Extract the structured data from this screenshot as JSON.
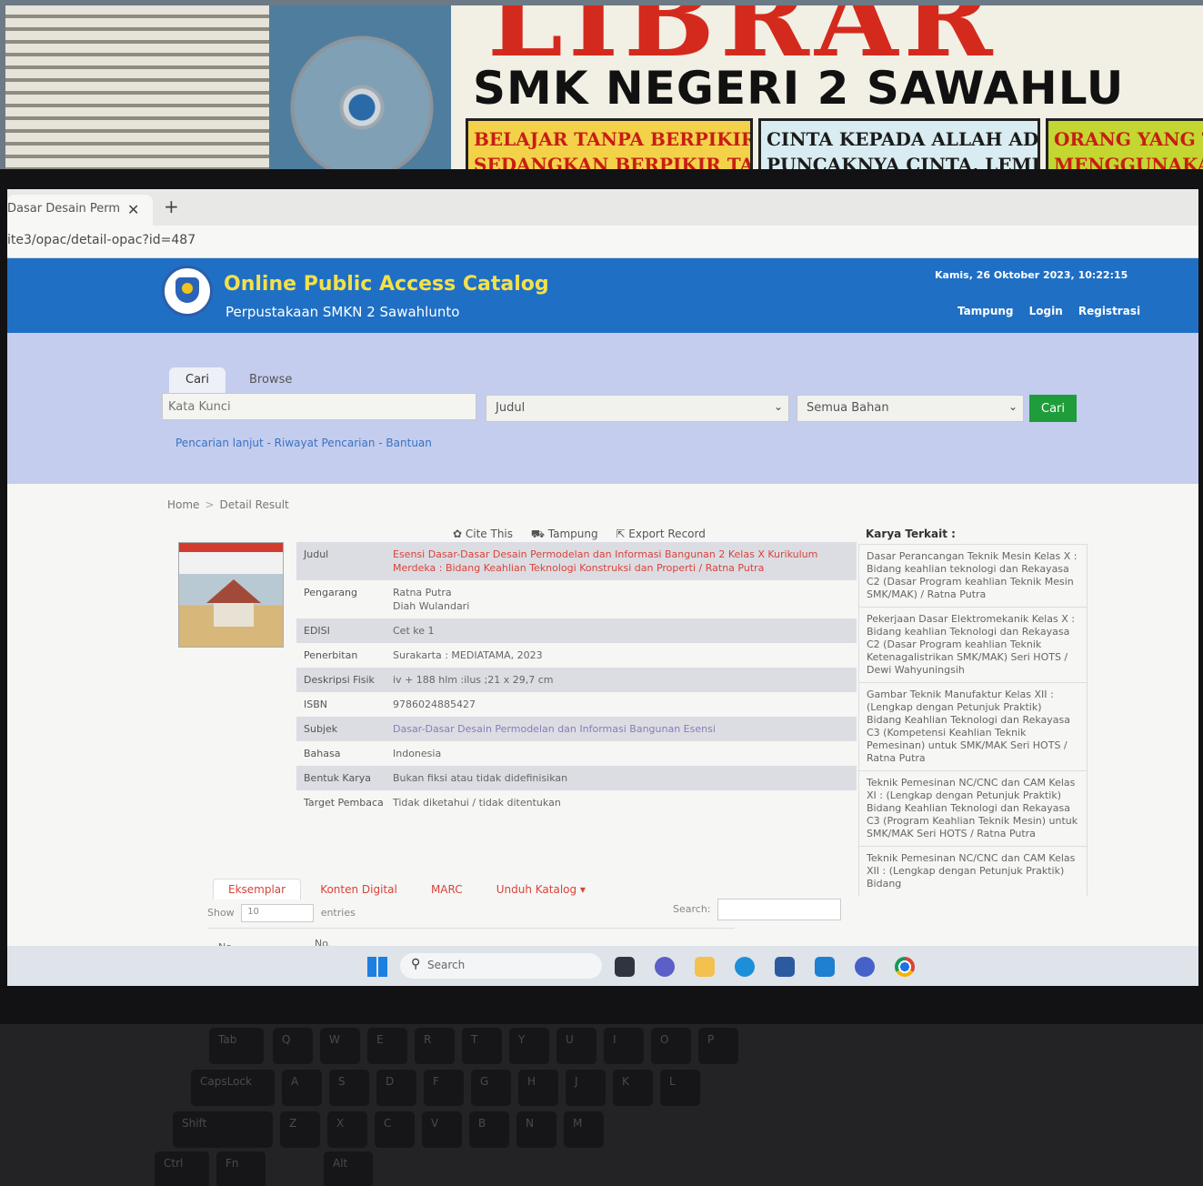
{
  "background": {
    "banner_big": "LIBRAR",
    "banner_school": "SMK NEGERI 2 SAWAHLU",
    "quote1": [
      "BELAJAR TANPA BERPIKIR TIDAK ADA GUNANYA,",
      "SEDANGKAN BERPIKIR TANPA BELAJAR"
    ],
    "quote2": [
      "CINTA KEPADA ALLAH ADALAH",
      "PUNCAKNYA CINTA, LEMBAHNYA CINTA"
    ],
    "quote3": [
      "ORANG YANG TE",
      "MENGGUNAKAN WAK"
    ]
  },
  "browser": {
    "tab_title": "Dasar Desain Perm",
    "tab_close": "✕",
    "new_tab": "+",
    "url": "ite3/opac/detail-opac?id=487"
  },
  "header": {
    "title": "Online Public Access Catalog",
    "subtitle": "Perpustakaan SMKN 2 Sawahlunto",
    "datetime": "Kamis, 26 Oktober 2023, 10:22:15",
    "nav": [
      "Tampung",
      "Login",
      "Registrasi"
    ]
  },
  "search": {
    "tabs": [
      "Cari",
      "Browse"
    ],
    "keyword_placeholder": "Kata Kunci",
    "field_select": "Judul",
    "material_select": "Semua Bahan",
    "submit_label": "Cari",
    "links": "Pencarian lanjut - Riwayat Pencarian - Bantuan"
  },
  "breadcrumb": {
    "home": "Home",
    "sep": ">",
    "current": "Detail Result"
  },
  "actions": {
    "cite": "✿ Cite This",
    "tampung": "⛟ Tampung",
    "export": "⇱ Export Record"
  },
  "detail": {
    "rows": [
      {
        "label": "Judul",
        "value": "Esensi Dasar-Dasar Desain Permodelan dan Informasi Bangunan 2 Kelas X Kurikulum Merdeka : Bidang Keahlian Teknologi Konstruksi dan Properti / Ratna Putra"
      },
      {
        "label": "Pengarang",
        "value": "Ratna Putra\nDiah Wulandari"
      },
      {
        "label": "EDISI",
        "value": "Cet ke 1"
      },
      {
        "label": "Penerbitan",
        "value": "Surakarta : MEDIATAMA, 2023"
      },
      {
        "label": "Deskripsi Fisik",
        "value": "iv + 188 hlm :ilus ;21 x 29,7 cm"
      },
      {
        "label": "ISBN",
        "value": "9786024885427"
      },
      {
        "label": "Subjek",
        "value": "Dasar-Dasar Desain Permodelan dan Informasi Bangunan Esensi"
      },
      {
        "label": "Bahasa",
        "value": "Indonesia"
      },
      {
        "label": "Bentuk Karya",
        "value": "Bukan fiksi atau tidak didefinisikan"
      },
      {
        "label": "Target Pembaca",
        "value": "Tidak diketahui / tidak ditentukan"
      }
    ]
  },
  "related": {
    "heading": "Karya Terkait :",
    "items": [
      "Dasar Perancangan Teknik Mesin Kelas X : Bidang keahlian teknologi dan Rekayasa C2 (Dasar Program keahlian Teknik Mesin SMK/MAK) / Ratna Putra",
      "Pekerjaan Dasar Elektromekanik Kelas X : Bidang keahlian Teknologi dan Rekayasa C2 (Dasar Program keahlian Teknik Ketenagalistrikan SMK/MAK) Seri HOTS / Dewi Wahyuningsih",
      "Gambar Teknik Manufaktur Kelas XII : (Lengkap dengan Petunjuk Praktik) Bidang Keahlian Teknologi dan Rekayasa C3 (Kompetensi Keahlian Teknik Pemesinan) untuk SMK/MAK Seri HOTS / Ratna Putra",
      "Teknik Pemesinan NC/CNC dan CAM Kelas XI : (Lengkap dengan Petunjuk Praktik) Bidang Keahlian Teknologi dan Rekayasa C3 (Program Keahlian Teknik Mesin) untuk SMK/MAK Seri HOTS / Ratna Putra",
      "Teknik Pemesinan NC/CNC dan CAM Kelas XII : (Lengkap dengan Petunjuk Praktik) Bidang"
    ]
  },
  "bottom_tabs": [
    "Eksemplar",
    "Konten Digital",
    "MARC",
    "Unduh Katalog ▾"
  ],
  "table": {
    "show_label": "Show",
    "show_value": "10",
    "entries_label": "entries",
    "search_label": "Search:",
    "col_no": "No",
    "col_no2": "No."
  },
  "taskbar": {
    "search_label": "Search"
  },
  "keyboard": {
    "row1": [
      "Tab",
      "Q",
      "W",
      "E",
      "R",
      "T",
      "Y",
      "U",
      "I",
      "O",
      "P"
    ],
    "row2": [
      "CapsLock",
      "A",
      "S",
      "D",
      "F",
      "G",
      "H",
      "J",
      "K",
      "L"
    ],
    "row3": [
      "Shift",
      "Z",
      "X",
      "C",
      "V",
      "B",
      "N",
      "M"
    ],
    "row4": [
      "Ctrl",
      "Fn",
      "Alt"
    ]
  }
}
